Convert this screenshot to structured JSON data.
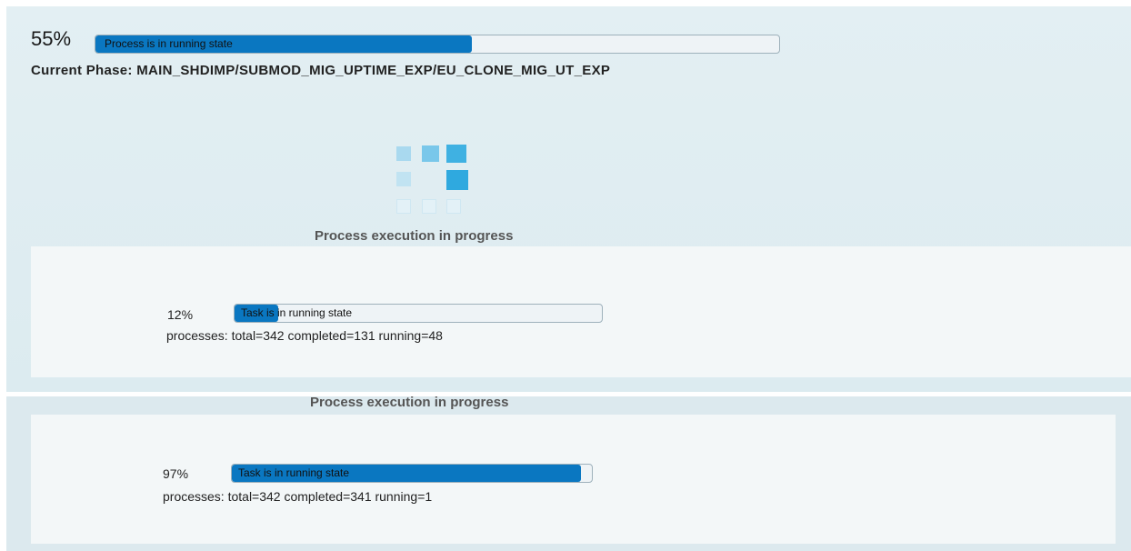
{
  "overall": {
    "percent_label": "55%",
    "progress": 0.55,
    "bar_text": "Process is in running state",
    "phase_text": "Current Phase: MAIN_SHDIMP/SUBMOD_MIG_UPTIME_EXP/EU_CLONE_MIG_UT_EXP"
  },
  "loading_indicator": {
    "icon": "loading-squares-icon"
  },
  "colors": {
    "bar_fill": "#0a77c1",
    "spinner_blue": "#3bb0e0"
  },
  "screens": [
    {
      "status_title": "Process execution in progress",
      "task": {
        "percent_label": "12%",
        "progress": 0.12,
        "bar_text": "Task is in running state",
        "processes_text": "processes: total=342 completed=131 running=48"
      }
    },
    {
      "status_title": "Process execution in progress",
      "task": {
        "percent_label": "97%",
        "progress": 0.97,
        "bar_text": "Task is in running state",
        "processes_text": "processes: total=342 completed=341 running=1"
      }
    }
  ]
}
